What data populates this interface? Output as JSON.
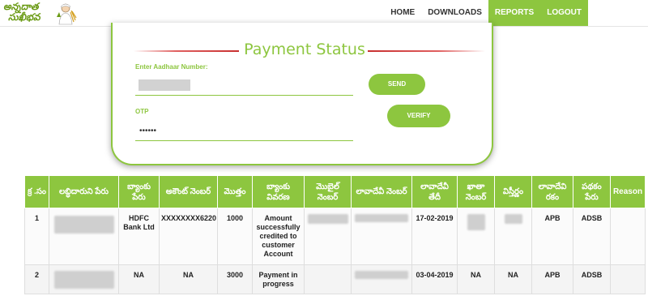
{
  "header": {
    "logo_line1": "అన్నదాత",
    "logo_line2": "సుఖీభవ",
    "nav": [
      "HOME",
      "DOWNLOADS",
      "REPORTS",
      "LOGOUT"
    ]
  },
  "form": {
    "title": "Payment Status",
    "aadhaar_label": "Enter Aadhaar Number:",
    "send_label": "SEND",
    "otp_label": "OTP",
    "otp_value": "••••••",
    "verify_label": "VERIFY"
  },
  "table": {
    "headers": [
      "క్ర .సం",
      "లబ్ధిదారుని పేరు",
      "బ్యాంకు పేరు",
      "అకౌంట్ నెంబర్",
      "మొత్తం",
      "బ్యాంకు వివరణ",
      "మొబైల్ నెంబర్",
      "లావాదేవీ నెంబర్",
      "లావాదేవీ తేదీ",
      "ఖాతా నెంబర్",
      "విస్తీర్ణం",
      "లావాదేవి రకం",
      "పథకం పేరు",
      "Reason"
    ],
    "rows": [
      {
        "sno": "1",
        "bank": "HDFC Bank Ltd",
        "account": "XXXXXXXX6220",
        "amount": "1000",
        "description": "Amount successfully credited to customer Account",
        "date": "17-02-2019",
        "txn_type": "APB",
        "scheme": "ADSB",
        "reason": ""
      },
      {
        "sno": "2",
        "bank": "NA",
        "account": "NA",
        "amount": "3000",
        "description": "Payment in progress",
        "date": "03-04-2019",
        "khata": "NA",
        "area": "NA",
        "txn_type": "APB",
        "scheme": "ADSB",
        "reason": ""
      }
    ]
  },
  "colors": {
    "accent": "#8dc63f",
    "title_rule": "#c83030"
  }
}
